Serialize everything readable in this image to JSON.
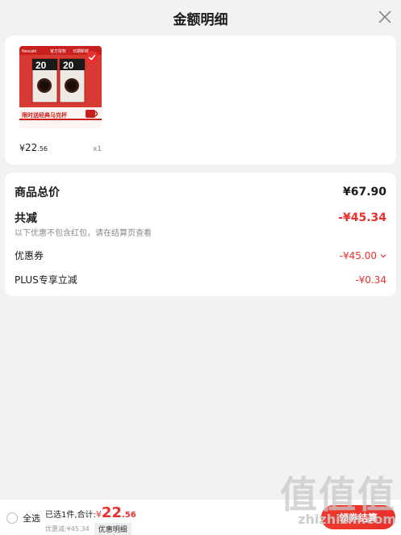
{
  "header": {
    "title": "金额明细"
  },
  "product": {
    "banner_brand": "Nescafé",
    "banner_tag1": "官方授权",
    "banner_tag2": "日期新鲜",
    "pack_number": "20",
    "promo_text": "限时送经典马克杯",
    "price_symbol": "¥",
    "price_int": "22",
    "price_dec": ".56",
    "quantity": "x1"
  },
  "summary": {
    "total_label": "商品总价",
    "total_value": "¥67.90",
    "reduce_label": "共减",
    "reduce_value": "-¥45.34",
    "note": "以下优惠不包含红包，请在结算页查看",
    "coupon_label": "优惠券",
    "coupon_value": "-¥45.00",
    "plus_label": "PLUS专享立减",
    "plus_value": "-¥0.34"
  },
  "bottom": {
    "select_all": "全选",
    "selected_text": "已选1件,合计:",
    "total_symbol": "¥",
    "total_int": "22",
    "total_dec": ".56",
    "discount_text": "优惠减:¥45.34",
    "detail_label": "优惠明细",
    "checkout_label": "领券结算"
  },
  "watermark": {
    "logo": "值值值",
    "text": "zhizhizhi.com"
  },
  "colors": {
    "accent": "#e9302c",
    "background": "#f2f2f2"
  }
}
